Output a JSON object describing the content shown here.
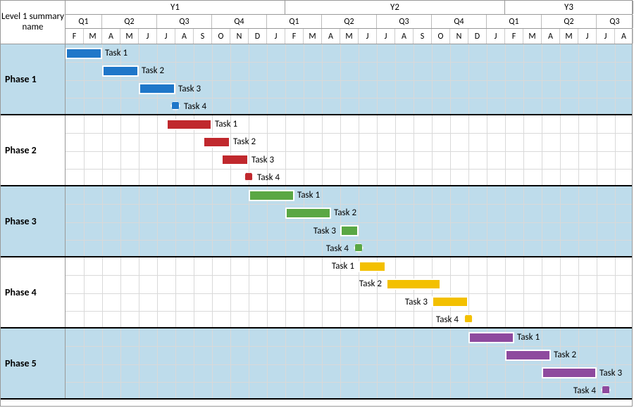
{
  "header": {
    "left_label": "Level 1 summary name",
    "years": [
      "Y1",
      "Y2",
      "Y3"
    ],
    "quarters": [
      "Q1",
      "Q2",
      "Q3",
      "Q4",
      "Q1",
      "Q2",
      "Q3",
      "Q4",
      "Q1",
      "Q2",
      "Q3"
    ],
    "months": [
      "F",
      "M",
      "A",
      "M",
      "J",
      "J",
      "A",
      "S",
      "O",
      "N",
      "D",
      "J",
      "F",
      "M",
      "A",
      "M",
      "J",
      "J",
      "A",
      "S",
      "O",
      "N",
      "D",
      "J",
      "F",
      "M",
      "A",
      "M",
      "J",
      "J",
      "A"
    ]
  },
  "phases": [
    {
      "name": "Phase 1",
      "shaded": true,
      "color": "blue",
      "tasks": [
        {
          "label": "Task 1",
          "type": "bar"
        },
        {
          "label": "Task 2",
          "type": "bar"
        },
        {
          "label": "Task 3",
          "type": "bar"
        },
        {
          "label": "Task 4",
          "type": "milestone"
        }
      ]
    },
    {
      "name": "Phase 2",
      "shaded": false,
      "color": "red",
      "tasks": [
        {
          "label": "Task 1",
          "type": "bar"
        },
        {
          "label": "Task 2",
          "type": "bar"
        },
        {
          "label": "Task 3",
          "type": "bar"
        },
        {
          "label": "Task 4",
          "type": "milestone"
        }
      ]
    },
    {
      "name": "Phase 3",
      "shaded": true,
      "color": "green",
      "tasks": [
        {
          "label": "Task 1",
          "type": "bar"
        },
        {
          "label": "Task 2",
          "type": "bar"
        },
        {
          "label": "Task 3",
          "type": "bar"
        },
        {
          "label": "Task 4",
          "type": "milestone"
        }
      ]
    },
    {
      "name": "Phase 4",
      "shaded": false,
      "color": "yellow",
      "tasks": [
        {
          "label": "Task 1",
          "type": "bar"
        },
        {
          "label": "Task 2",
          "type": "bar"
        },
        {
          "label": "Task 3",
          "type": "bar"
        },
        {
          "label": "Task 4",
          "type": "milestone"
        }
      ]
    },
    {
      "name": "Phase 5",
      "shaded": true,
      "color": "purple",
      "tasks": [
        {
          "label": "Task 1",
          "type": "bar"
        },
        {
          "label": "Task 2",
          "type": "bar"
        },
        {
          "label": "Task 3",
          "type": "bar"
        },
        {
          "label": "Task 4",
          "type": "milestone"
        }
      ]
    }
  ],
  "chart_data": {
    "type": "bar",
    "title": "",
    "xlabel": "",
    "ylabel": "",
    "x_months": [
      "F",
      "M",
      "A",
      "M",
      "J",
      "J",
      "A",
      "S",
      "O",
      "N",
      "D",
      "J",
      "F",
      "M",
      "A",
      "M",
      "J",
      "J",
      "A",
      "S",
      "O",
      "N",
      "D",
      "J",
      "F",
      "M",
      "A",
      "M",
      "J",
      "J",
      "A"
    ],
    "series": [
      {
        "name": "Phase 1",
        "color": "#1f77c9",
        "items": [
          {
            "label": "Task 1",
            "kind": "bar",
            "start_month": 0,
            "end_month": 2
          },
          {
            "label": "Task 2",
            "kind": "bar",
            "start_month": 2,
            "end_month": 4
          },
          {
            "label": "Task 3",
            "kind": "bar",
            "start_month": 4,
            "end_month": 6
          },
          {
            "label": "Task 4",
            "kind": "milestone",
            "month": 6
          }
        ]
      },
      {
        "name": "Phase 2",
        "color": "#c0282d",
        "items": [
          {
            "label": "Task 1",
            "kind": "bar",
            "start_month": 5.5,
            "end_month": 8
          },
          {
            "label": "Task 2",
            "kind": "bar",
            "start_month": 7.5,
            "end_month": 9
          },
          {
            "label": "Task 3",
            "kind": "bar",
            "start_month": 8.5,
            "end_month": 10
          },
          {
            "label": "Task 4",
            "kind": "milestone",
            "month": 10
          }
        ]
      },
      {
        "name": "Phase 3",
        "color": "#5aa744",
        "items": [
          {
            "label": "Task 1",
            "kind": "bar",
            "start_month": 10,
            "end_month": 12.5
          },
          {
            "label": "Task 2",
            "kind": "bar",
            "start_month": 12,
            "end_month": 14.5
          },
          {
            "label": "Task 3",
            "kind": "bar",
            "start_month": 15,
            "end_month": 16
          },
          {
            "label": "Task 4",
            "kind": "milestone",
            "month": 16
          }
        ]
      },
      {
        "name": "Phase 4",
        "color": "#f3c000",
        "items": [
          {
            "label": "Task 1",
            "kind": "bar",
            "start_month": 16,
            "end_month": 17.5
          },
          {
            "label": "Task 2",
            "kind": "bar",
            "start_month": 17.5,
            "end_month": 20.5
          },
          {
            "label": "Task 3",
            "kind": "bar",
            "start_month": 20,
            "end_month": 22
          },
          {
            "label": "Task 4",
            "kind": "milestone",
            "month": 22
          }
        ]
      },
      {
        "name": "Phase 5",
        "color": "#8e4a9e",
        "items": [
          {
            "label": "Task 1",
            "kind": "bar",
            "start_month": 22,
            "end_month": 24.5
          },
          {
            "label": "Task 2",
            "kind": "bar",
            "start_month": 24,
            "end_month": 26.5
          },
          {
            "label": "Task 3",
            "kind": "bar",
            "start_month": 26,
            "end_month": 29
          },
          {
            "label": "Task 4",
            "kind": "milestone",
            "month": 29.5
          }
        ]
      }
    ]
  }
}
